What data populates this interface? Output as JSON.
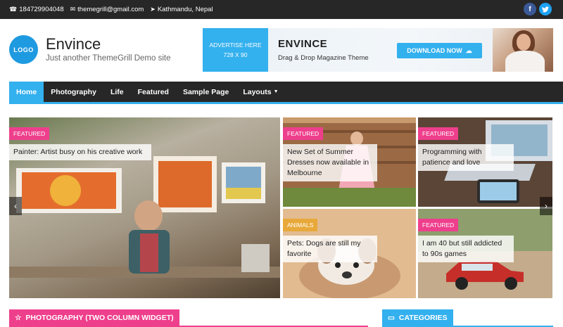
{
  "topbar": {
    "phone": "184729904048",
    "email": "themegrill@gmail.com",
    "location": "Kathmandu, Nepal",
    "social": [
      {
        "name": "facebook-icon",
        "glyph": "f",
        "color": "#3b5998"
      },
      {
        "name": "twitter-icon",
        "glyph": "t",
        "color": "#1da1f2"
      }
    ]
  },
  "header": {
    "logo_text": "LOGO",
    "site_title": "Envince",
    "site_description": "Just another ThemeGrill Demo site"
  },
  "ad": {
    "label_line1": "ADVERTISE HERE",
    "label_line2": "728 X 90",
    "brand": "ENVINCE",
    "tagline": "Drag & Drop Magazine Theme",
    "download_label": "DOWNLOAD NOW"
  },
  "nav": {
    "items": [
      {
        "label": "Home",
        "active": true
      },
      {
        "label": "Photography"
      },
      {
        "label": "Life"
      },
      {
        "label": "Featured"
      },
      {
        "label": "Sample Page"
      },
      {
        "label": "Layouts",
        "dropdown": true
      }
    ]
  },
  "slider": {
    "tiles": [
      {
        "category": "FEATURED",
        "category_color": "#ee3f8c",
        "title": "Painter: Artist busy on his creative work"
      },
      {
        "category": "FEATURED",
        "category_color": "#ee3f8c",
        "title": "New Set of Summer Dresses now available in Melbourne"
      },
      {
        "category": "FEATURED",
        "category_color": "#ee3f8c",
        "title": "Programming with patience and love"
      },
      {
        "category": "ANIMALS",
        "category_color": "#e8a93a",
        "title": "Pets: Dogs are still my favorite"
      },
      {
        "category": "FEATURED",
        "category_color": "#ee3f8c",
        "title": "I am 40 but still addicted to 90s games"
      }
    ]
  },
  "widgets": {
    "photography_title": "PHOTOGRAPHY (TWO COLUMN WIDGET)",
    "categories_title": "CATEGORIES"
  },
  "colors": {
    "accent": "#33b0ee",
    "pink": "#ee3f8c",
    "dark": "#272727"
  }
}
